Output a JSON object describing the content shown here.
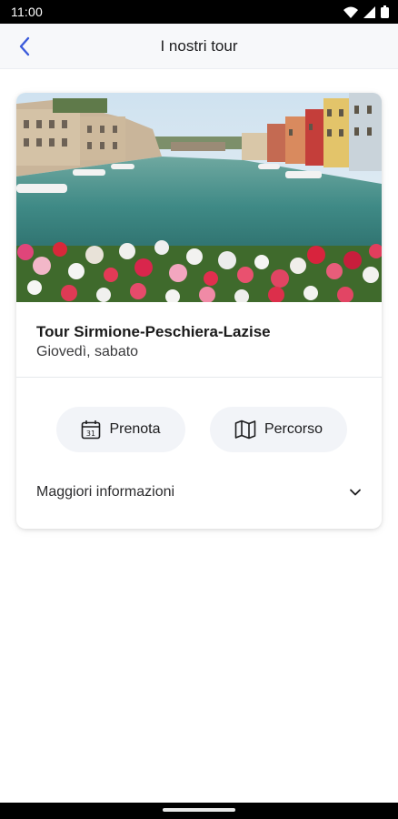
{
  "status_bar": {
    "time": "11:00",
    "icons": [
      "wifi-icon",
      "signal-icon",
      "battery-icon"
    ]
  },
  "app_bar": {
    "title": "I nostri tour",
    "back_icon": "chevron-left-icon"
  },
  "tour_card": {
    "image": "lakeside-canal-with-flowers",
    "title": "Tour Sirmione-Peschiera-Lazise",
    "subtitle": "Giovedì, sabato",
    "book_button": {
      "label": "Prenota",
      "icon": "calendar-31-icon"
    },
    "route_button": {
      "label": "Percorso",
      "icon": "map-icon"
    },
    "more_info": {
      "label": "Maggiori informazioni",
      "icon": "chevron-down-icon"
    }
  },
  "colors": {
    "accent": "#3b5bdb",
    "pill_bg": "#f2f4f8",
    "app_bar_bg": "#f7f8fa"
  }
}
